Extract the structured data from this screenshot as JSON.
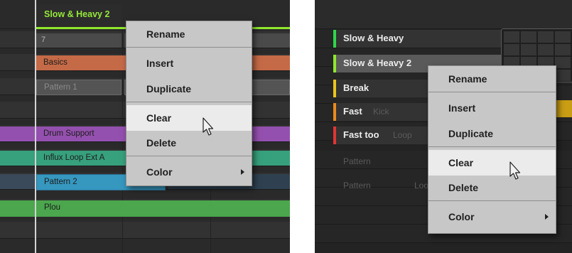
{
  "colors": {
    "scene_green": "#8fe82c",
    "basics": "#c46a47",
    "pattern_gray": "#545454",
    "drum_support": "#9450ae",
    "influx": "#37a07c",
    "pattern2": "#3697bf",
    "plou": "#4ba64d",
    "menu_bg": "#c7c7c7",
    "menu_hover": "#ebebeb"
  },
  "arranger": {
    "scene_label": "Slow & Heavy 2",
    "ruler_number": "7",
    "clips": [
      {
        "label": "Basics",
        "color": "#c46a47"
      },
      {
        "label": "Pattern 1",
        "color": "#545454"
      },
      {
        "label": "Drum Support",
        "color": "#9450ae"
      },
      {
        "label": "Influx Loop Ext A",
        "color": "#37a07c"
      },
      {
        "label": "Pattern 2",
        "color": "#3697bf"
      },
      {
        "label": "Plou",
        "color": "#4ba64d"
      }
    ]
  },
  "scene_list": {
    "items": [
      {
        "label": "Slow & Heavy",
        "color": "#2fd64a",
        "selected": false
      },
      {
        "label": "Slow & Heavy 2",
        "color": "#8fe82c",
        "selected": true
      },
      {
        "label": "Break",
        "color": "#e9c51d",
        "selected": false
      },
      {
        "label": "Fast",
        "color": "#ea8a1d",
        "selected": false
      },
      {
        "label": "Fast too",
        "color": "#e03535",
        "selected": false
      }
    ],
    "ghost_texts": [
      "Kick",
      "Loop",
      "Pattern",
      "Pattern",
      "Loop"
    ]
  },
  "context_menu": {
    "items": [
      "Rename",
      "Insert",
      "Duplicate",
      "Clear",
      "Delete",
      "Color"
    ],
    "hovered": "Clear",
    "submenu": "Color",
    "cursor_icon": "arrow-cursor-icon"
  }
}
